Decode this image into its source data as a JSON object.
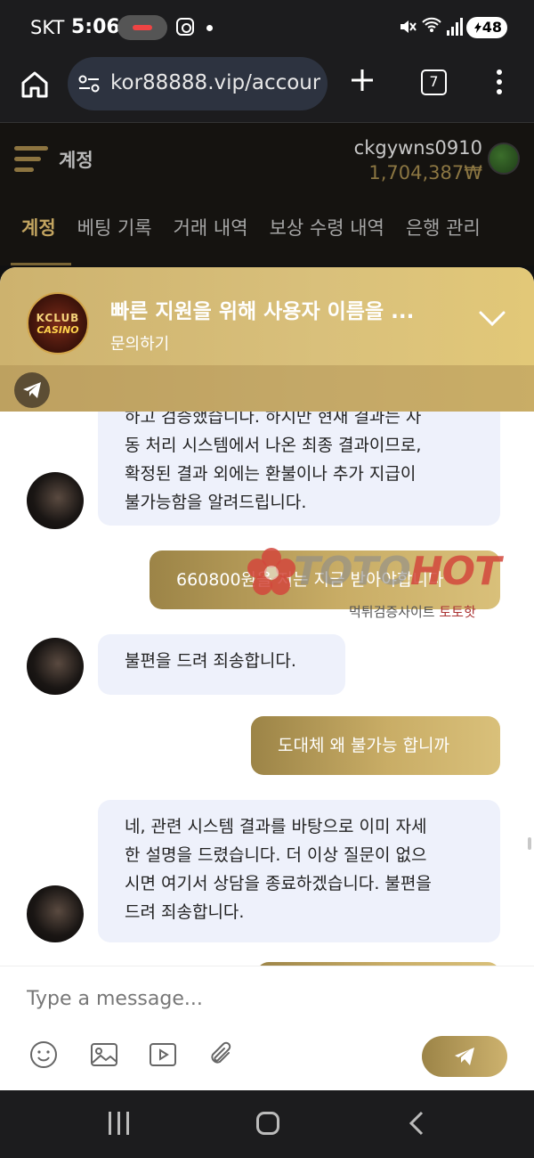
{
  "status_bar": {
    "carrier": "SKT",
    "time": "5:06",
    "battery": "48"
  },
  "browser": {
    "url": "kor88888.vip/accoun",
    "tab_count": "7"
  },
  "site": {
    "header_title": "계정",
    "username": "ckgywns0910",
    "balance": "1,704,387₩",
    "tabs": [
      "계정",
      "베팅 기록",
      "거래 내역",
      "보상 수령 내역",
      "은행 관리"
    ]
  },
  "chat": {
    "title": "빠른 지원을 위해 사용자 이름을 ...",
    "subtitle": "문의하기",
    "logo_line1": "KCLUB",
    "logo_line2": "CASINO",
    "messages": [
      {
        "from": "agent",
        "lines": [
          "하고 검증했습니다. 하지만 현재 결과는 자",
          "동 처리 시스템에서 나온 최종 결과이므로,",
          "확정된 결과 외에는 환불이나 추가 지급이",
          "불가능함을 알려드립니다."
        ]
      },
      {
        "from": "user",
        "text": "660800원을 저는 지금 받아야합니다"
      },
      {
        "from": "agent",
        "lines": [
          "불편을 드려 죄송합니다."
        ]
      },
      {
        "from": "user",
        "text": "도대체 왜 불가능 합니까"
      },
      {
        "from": "agent",
        "lines": [
          "네, 관련 시스템 결과를 바탕으로 이미 자세",
          "한 설명을 드렸습니다. 더 이상 질문이 없으",
          "시면 여기서 상담을 종료하겠습니다. 불편을",
          "드려 죄송합니다."
        ]
      }
    ],
    "input_placeholder": "Type a message...",
    "watermark": {
      "brand_a": "TOTO",
      "brand_b": "HOT",
      "sub_a": "먹튀검증사이트 ",
      "sub_b": "토토핫"
    }
  },
  "colors": {
    "gold": "#c9ad66",
    "agent_bubble": "#eef1fb",
    "watermark_red": "#d2463c"
  }
}
